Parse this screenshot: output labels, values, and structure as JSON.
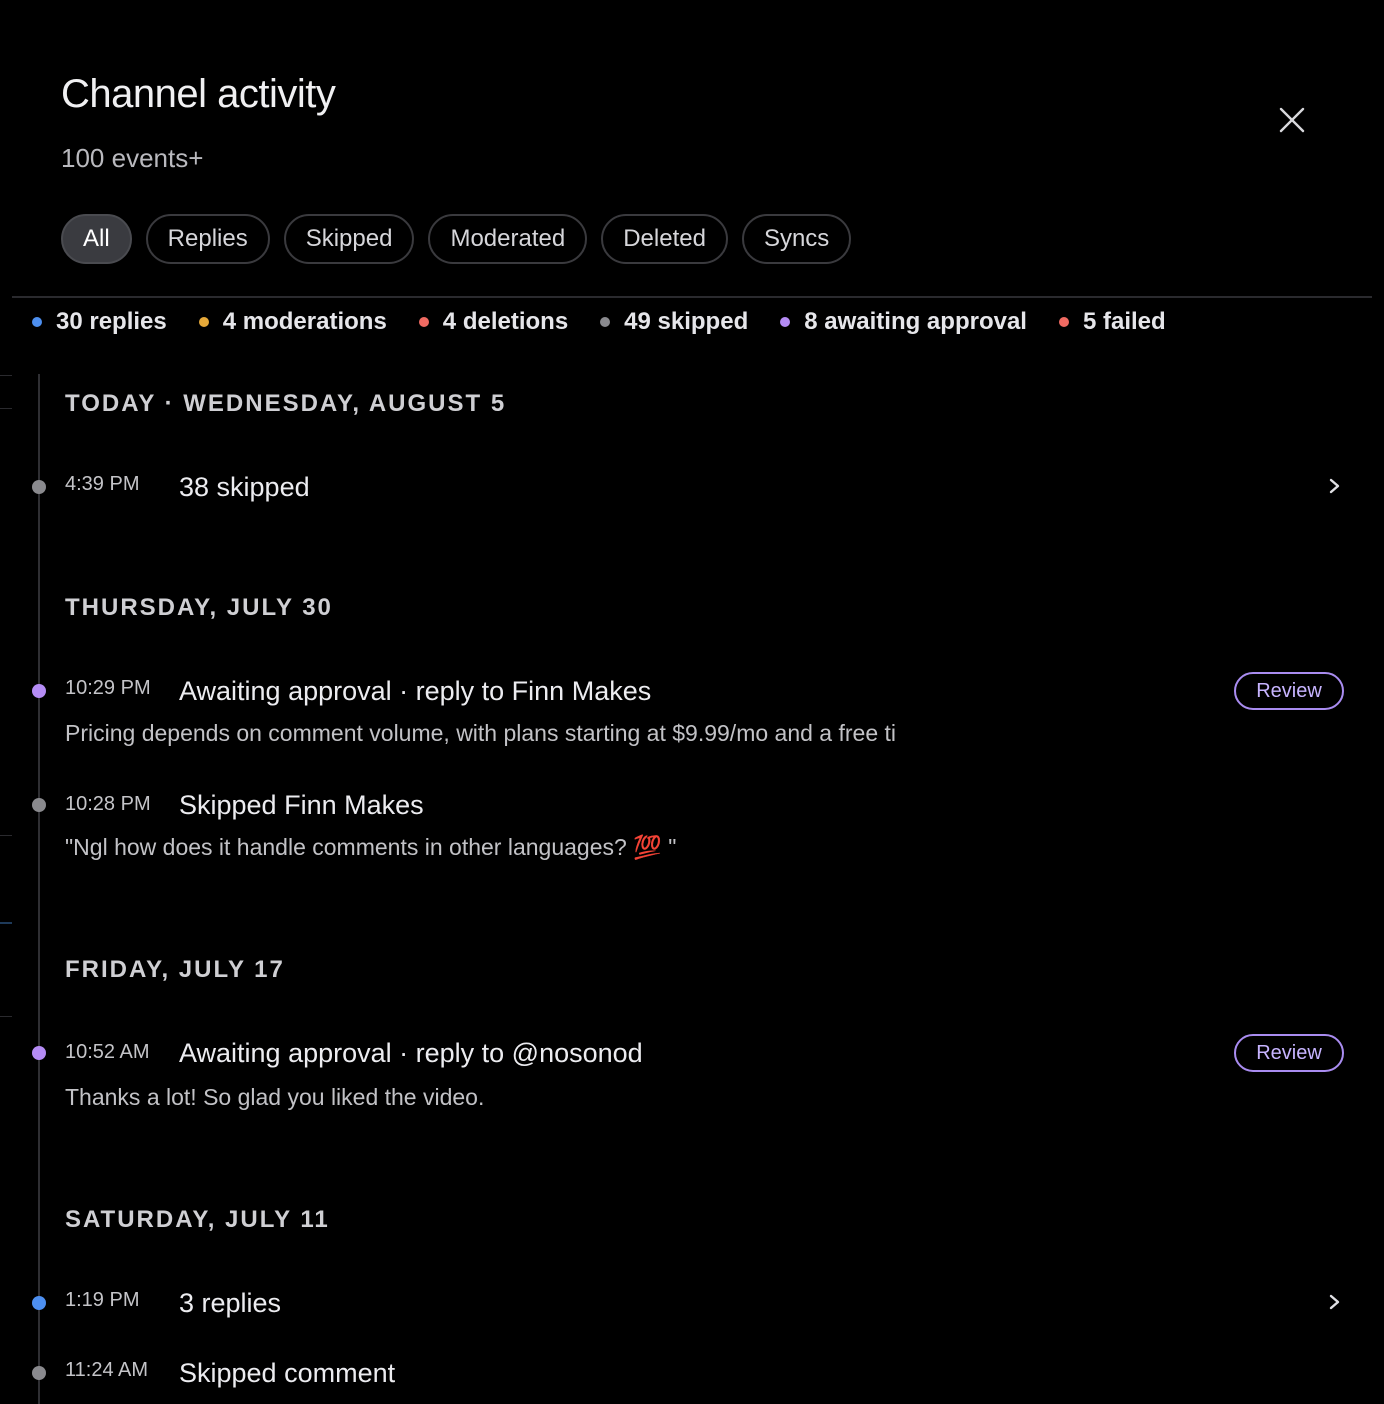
{
  "header": {
    "title": "Channel activity",
    "subtitle": "100 events+"
  },
  "filters": [
    "All",
    "Replies",
    "Skipped",
    "Moderated",
    "Deleted",
    "Syncs"
  ],
  "active_filter": "All",
  "summary": [
    {
      "label": "30 replies",
      "color": "#4d8ff0"
    },
    {
      "label": "4 moderations",
      "color": "#e6a93a"
    },
    {
      "label": "4 deletions",
      "color": "#f06a62"
    },
    {
      "label": "49 skipped",
      "color": "#8a8a8e"
    },
    {
      "label": "8 awaiting approval",
      "color": "#b58cf5"
    },
    {
      "label": "5 failed",
      "color": "#f06a62"
    }
  ],
  "days": {
    "d1": "TODAY · WEDNESDAY, AUGUST 5",
    "d2": "THURSDAY, JULY 30",
    "d3": "FRIDAY, JULY 17",
    "d4": "SATURDAY, JULY 11"
  },
  "events": {
    "e1": {
      "time": "4:39 PM",
      "title": "38 skipped",
      "dot_color": "#8a8a8e"
    },
    "e2": {
      "time": "10:29 PM",
      "title": "Awaiting approval · reply to Finn Makes",
      "body": "Pricing depends on comment volume, with plans starting at $9.99/mo and a free ti",
      "action": "Review",
      "dot_color": "#b58cf5"
    },
    "e3": {
      "time": "10:28 PM",
      "title": "Skipped Finn Makes",
      "body": "\"Ngl how does it handle comments in other languages? 💯 \"",
      "dot_color": "#8a8a8e"
    },
    "e4": {
      "time": "10:52 AM",
      "title": "Awaiting approval · reply to @nosonod",
      "body": "Thanks a lot! So glad you liked the video.",
      "action": "Review",
      "dot_color": "#b58cf5"
    },
    "e5": {
      "time": "1:19 PM",
      "title": "3 replies",
      "dot_color": "#4d8ff0"
    },
    "e6": {
      "time": "11:24 AM",
      "title": "Skipped comment",
      "dot_color": "#8a8a8e"
    }
  },
  "icons": {
    "close": "close-icon",
    "chevron": "chevron-right-icon"
  }
}
